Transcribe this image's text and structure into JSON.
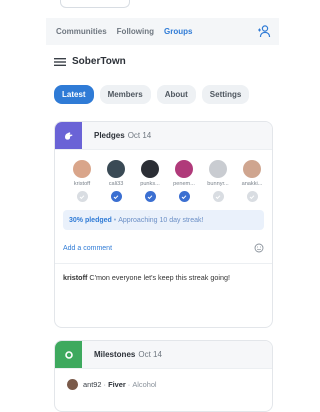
{
  "top_nav": {
    "tabs": [
      "Communities",
      "Following",
      "Groups"
    ],
    "active_index": 2
  },
  "group": {
    "name": "SoberTown"
  },
  "group_tabs": [
    "Latest",
    "Members",
    "About",
    "Settings"
  ],
  "pledges_card": {
    "title": "Pledges",
    "date": "Oct 14",
    "people": [
      {
        "name": "kristoff",
        "checked": false,
        "color": "#d9a58a"
      },
      {
        "name": "cali33",
        "checked": true,
        "color": "#3a4a55"
      },
      {
        "name": "punks...",
        "checked": true,
        "color": "#2b2e35"
      },
      {
        "name": "penem...",
        "checked": true,
        "color": "#b03a7a"
      },
      {
        "name": "bunnyr...",
        "checked": false,
        "color": "#c9ccd1"
      },
      {
        "name": "anakki...",
        "checked": false,
        "color": "#cfa58f"
      }
    ],
    "progress_pct_text": "30% pledged",
    "progress_message": "Approaching 10 day streak!",
    "add_comment": "Add a comment",
    "comment_author": "kristoff",
    "comment_text": "C'mon everyone let's keep this streak going!",
    "accent": "#6a63d6"
  },
  "milestones_card": {
    "title": "Milestones",
    "date": "Oct 14",
    "member": "ant92",
    "role": "Fiver",
    "tag": "Alcohol",
    "accent": "#3ea95e"
  }
}
